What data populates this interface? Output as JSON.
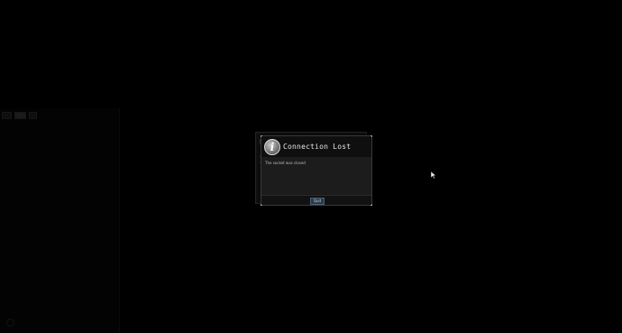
{
  "background": {
    "tabs": [
      {
        "label": "··"
      },
      {
        "label": "····"
      },
      {
        "label": "·"
      }
    ]
  },
  "dialog": {
    "title": "Connection Lost",
    "message": "The socket was closed",
    "quit_label": "Quit",
    "icon": "info-icon",
    "accent_color": "#2a3947"
  },
  "ghost_dialog": {
    "icon": "info-icon"
  }
}
